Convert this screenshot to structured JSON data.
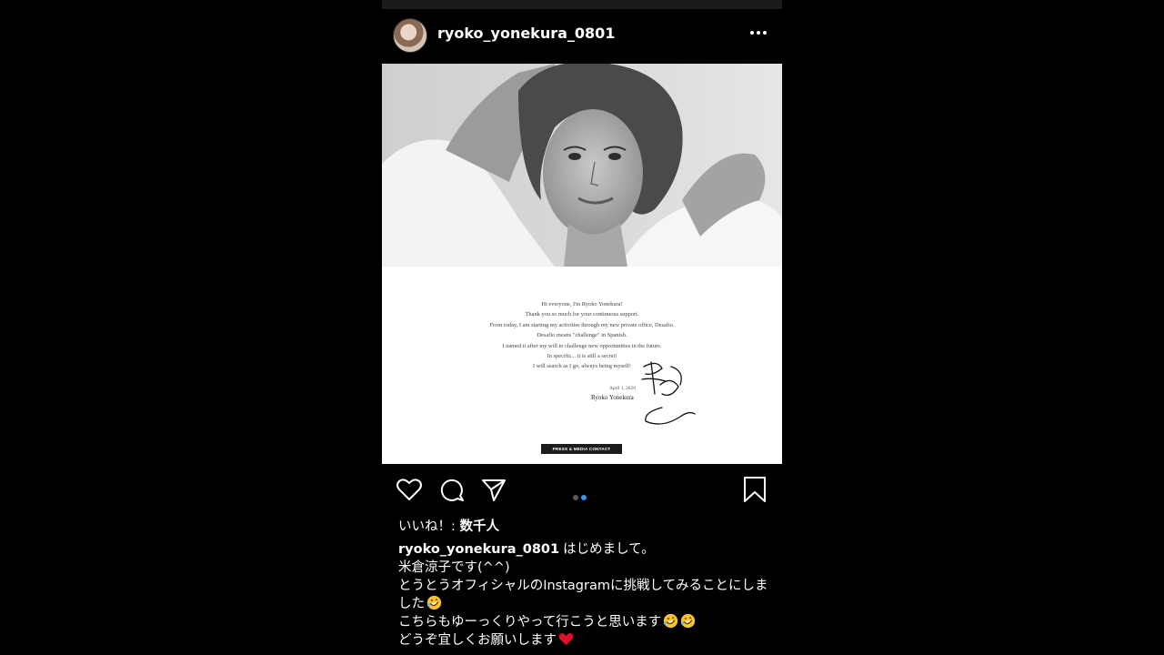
{
  "post": {
    "username": "ryoko_yonekura_0801",
    "more_icon": "more-horizontal-icon"
  },
  "letter": {
    "lines": [
      "Hi everyone, I'm Ryoko Yonekura!",
      "Thank you so much for your continuous support.",
      "From today, I am starting my activities through my new private office, Desafio.",
      "Desafio means \"challenge\" in Spanish.",
      "I named it after my will to challenge new opportunities in the future.",
      "In specific... it is still a secret!",
      "I will search as I go, always being myself!"
    ],
    "date": "April 1, 2020",
    "name": "Ryoko Yonekura",
    "press_button": "PRESS & MEDIA CONTACT"
  },
  "actions": {
    "icons": [
      "heart-icon",
      "comment-icon",
      "share-icon",
      "bookmark-icon"
    ],
    "carousel_active_color": "#3897f0",
    "carousel_inactive_color": "#5a5a5a"
  },
  "likes": {
    "label": "いいね！: ",
    "count": "数千人"
  },
  "caption": {
    "username": "ryoko_yonekura_0801",
    "line1": "はじめまして。",
    "line2": "米倉涼子です(^^)",
    "line3": "とうとうオフィシャルのInstagramに挑戦してみることにしました",
    "line4": "こちらもゆーっくりやって行こうと思います",
    "line5": "どうぞ宜しくお願いします"
  }
}
